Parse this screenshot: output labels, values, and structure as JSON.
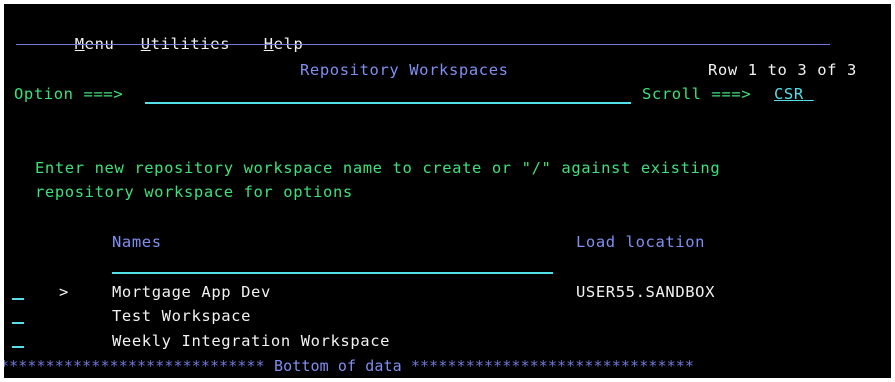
{
  "menu": {
    "items": [
      {
        "accel": "M",
        "rest": "enu"
      },
      {
        "accel": "U",
        "rest": "tilities"
      },
      {
        "accel": "H",
        "rest": "elp"
      }
    ]
  },
  "header": {
    "title": "Repository Workspaces",
    "row_info": "Row 1 to 3 of 3"
  },
  "command": {
    "option_label": "Option ===>",
    "option_value": "",
    "scroll_label": "Scroll ===>",
    "scroll_value": "CSR"
  },
  "instructions": {
    "line1": "Enter new repository workspace name to create or \"/\" against existing",
    "line2": "repository workspace for options"
  },
  "table": {
    "col_names": "Names",
    "col_load": "Load location",
    "rows": [
      {
        "marker": ">",
        "name": "Mortgage App Dev",
        "load": "USER55.SANDBOX"
      },
      {
        "marker": "",
        "name": "Test Workspace",
        "load": ""
      },
      {
        "marker": "",
        "name": "Weekly Integration Workspace",
        "load": ""
      }
    ]
  },
  "footer": {
    "bottom_text": "Bottom of data",
    "stars_left": "*****************************",
    "stars_right": "*******************************"
  },
  "colors": {
    "background": "#000000",
    "white_text": "#f2f2f2",
    "blue_text": "#7f8ff0",
    "green_text": "#3ee07a",
    "turquoise_field": "#53e0e8"
  }
}
